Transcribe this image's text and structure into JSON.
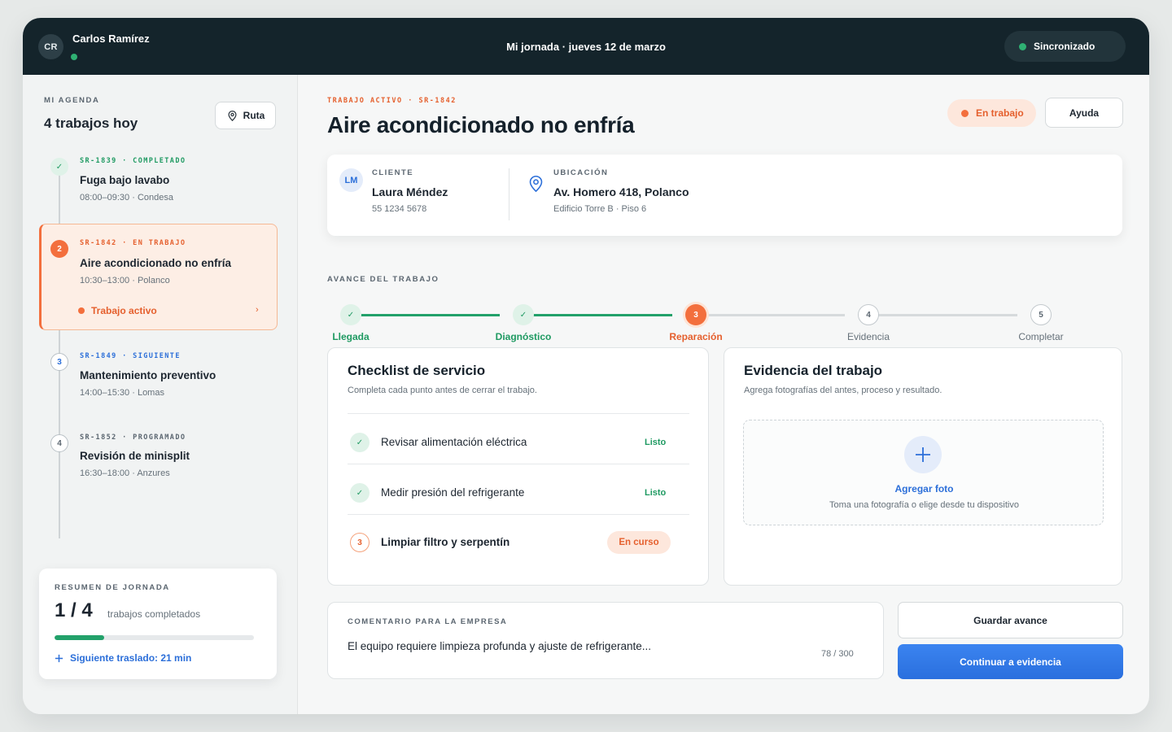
{
  "header": {
    "user_initials": "CR",
    "user_name": "Carlos Ramírez",
    "title": "Mi jornada · jueves 12 de marzo",
    "sync_status": "Sincronizado"
  },
  "sidebar": {
    "eyebrow": "MI AGENDA",
    "title": "4 trabajos hoy",
    "route_label": "Ruta",
    "jobs": [
      {
        "marker": "✓",
        "meta": "SR-1839 · COMPLETADO",
        "title": "Fuga bajo lavabo",
        "sub": "08:00–09:30 · Condesa",
        "state": "done"
      },
      {
        "marker": "2",
        "meta": "SR-1842 · EN TRABAJO",
        "title": "Aire acondicionado no enfría",
        "sub": "10:30–13:00 · Polanco",
        "state": "active",
        "link": "Trabajo activo"
      },
      {
        "marker": "3",
        "meta": "SR-1849 · SIGUIENTE",
        "title": "Mantenimiento preventivo",
        "sub": "14:00–15:30 · Lomas",
        "state": "next"
      },
      {
        "marker": "4",
        "meta": "SR-1852 · PROGRAMADO",
        "title": "Revisión de minisplit",
        "sub": "16:30–18:00 · Anzures",
        "state": "scheduled"
      }
    ],
    "summary": {
      "eyebrow": "RESUMEN DE JORNADA",
      "count": "1 / 4",
      "label": "trabajos completados",
      "progress": 0.25,
      "next_transfer": "Siguiente traslado: 21 min"
    }
  },
  "main": {
    "eyebrow": "TRABAJO ACTIVO · SR-1842",
    "title": "Aire acondicionado no enfría",
    "status": "En trabajo",
    "help_label": "Ayuda",
    "client": {
      "initials": "LM",
      "eyebrow": "CLIENTE",
      "name": "Laura Méndez",
      "phone": "55 1234 5678"
    },
    "location": {
      "eyebrow": "UBICACIÓN",
      "address": "Av. Homero 418, Polanco",
      "detail": "Edificio Torre B · Piso 6"
    },
    "progress_eyebrow": "AVANCE DEL TRABAJO",
    "steps": [
      {
        "marker": "✓",
        "label": "Llegada",
        "state": "done"
      },
      {
        "marker": "✓",
        "label": "Diagnóstico",
        "state": "done"
      },
      {
        "marker": "3",
        "label": "Reparación",
        "state": "active"
      },
      {
        "marker": "4",
        "label": "Evidencia",
        "state": "todo"
      },
      {
        "marker": "5",
        "label": "Completar",
        "state": "todo"
      }
    ],
    "checklist": {
      "title": "Checklist de servicio",
      "subtitle": "Completa cada punto antes de cerrar el trabajo.",
      "items": [
        {
          "marker": "✓",
          "label": "Revisar alimentación eléctrica",
          "status": "Listo",
          "state": "done"
        },
        {
          "marker": "✓",
          "label": "Medir presión del refrigerante",
          "status": "Listo",
          "state": "done"
        },
        {
          "marker": "3",
          "label": "Limpiar filtro y serpentín",
          "status": "En curso",
          "state": "active"
        }
      ]
    },
    "evidence": {
      "title": "Evidencia del trabajo",
      "subtitle": "Agrega fotografías del antes, proceso y resultado.",
      "add_title": "Agregar foto",
      "add_subtitle": "Toma una fotografía o elige desde tu dispositivo"
    },
    "comment": {
      "eyebrow": "COMENTARIO PARA LA EMPRESA",
      "text": "El equipo requiere limpieza profunda y ajuste de refrigerante...",
      "count": "78 / 300"
    },
    "save_label": "Guardar avance",
    "continue_label": "Continuar a evidencia"
  },
  "colors": {
    "topbar": "#14242b",
    "accent_orange": "#f36f3d",
    "success_green": "#1f9a62",
    "primary_blue": "#2c6fd9"
  }
}
